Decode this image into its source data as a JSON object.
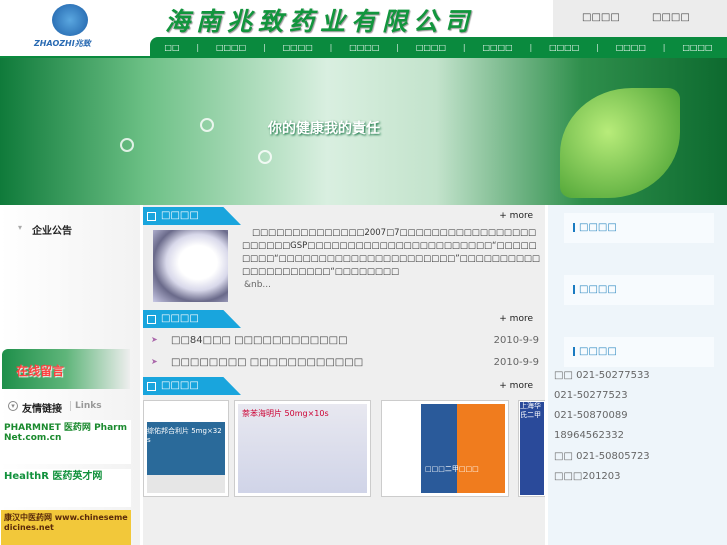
{
  "header": {
    "logo_text": "ZHAOZHI兆致",
    "company_title": "海南兆致药业有限公司",
    "top_links": [
      "□□□□",
      "□□□□"
    ]
  },
  "nav": [
    "□□",
    "□□□□",
    "□□□□",
    "□□□□",
    "□□□□",
    "□□□□",
    "□□□□",
    "□□□□",
    "□□□□"
  ],
  "banner": {
    "slogan": "你的健康我的責任"
  },
  "left": {
    "notice_title": "企业公告",
    "online_message": "在线留言",
    "links_title": "友情链接",
    "links_en": "Links",
    "link_logos": [
      "PHARMNET 医药网 PharmNet.com.cn",
      "HealthR 医药英才网",
      "康汉中医药网 www.chinesemedicines.net"
    ]
  },
  "main": {
    "about": {
      "title": "□□□□",
      "more": "+ more",
      "text": "□□□□□□□□□□□□□□2007□7□□□□□□□□□□□□□□□□□□□□□□□GSP□□□□□□□□□□□□□□□□□□□□□□□“□□□□□□□□□“□□□□□□□□□□□□□□□□□□□□□□”□□□□□□□□□□□□□□□□□□□□□“□□□□□□□□",
      "ellipsis": "&nb..."
    },
    "news": {
      "title": "□□□□",
      "more": "+ more",
      "items": [
        {
          "title": "□□84□□□ □□□□□□□□□□□□",
          "date": "2010-9-9"
        },
        {
          "title": "□□□□□□□□ □□□□□□□□□□□□",
          "date": "2010-9-9"
        }
      ]
    },
    "products": {
      "title": "□□□□",
      "more": "+ more",
      "items": [
        "综佑邦合利片 5mg×32s",
        "萘苯海明片 50mg×10s",
        "□□□二甲□□□",
        "上海华氏二甲"
      ]
    }
  },
  "right": {
    "headers": [
      "□□□□",
      "□□□□",
      "□□□□"
    ],
    "contact": [
      "□□ 021-50277533",
      "021-50277523",
      "021-50870089",
      "18964562332",
      "□□ 021-50805723",
      "□□□201203"
    ]
  },
  "colors": {
    "brand_green": "#0a8a3e",
    "section_blue": "#19a5dd"
  }
}
